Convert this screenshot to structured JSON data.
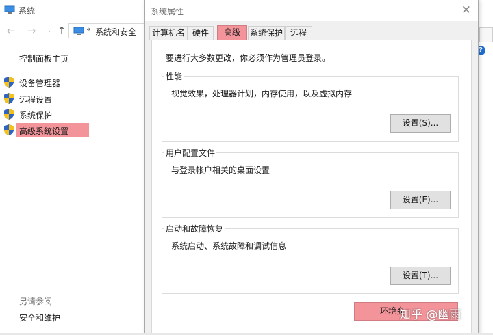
{
  "background_window": {
    "title": "系统",
    "address": {
      "separator": "«",
      "path": "系统和安全"
    },
    "left_nav": {
      "home": "控制面板主页",
      "items": [
        {
          "label": "设备管理器",
          "icon": "uac-shield-icon",
          "selected": false
        },
        {
          "label": "远程设置",
          "icon": "uac-shield-icon",
          "selected": false
        },
        {
          "label": "系统保护",
          "icon": "uac-shield-icon",
          "selected": false
        },
        {
          "label": "高级系统设置",
          "icon": "uac-shield-icon",
          "selected": true
        }
      ],
      "see_also": "另请参阅",
      "security_link": "安全和维护"
    },
    "help_glyph": "?"
  },
  "dialog": {
    "title": "系统属性",
    "close_glyph": "✕",
    "tabs": [
      {
        "label": "计算机名",
        "active": false
      },
      {
        "label": "硬件",
        "active": false
      },
      {
        "label": "高级",
        "active": true
      },
      {
        "label": "系统保护",
        "active": false
      },
      {
        "label": "远程",
        "active": false
      }
    ],
    "note": "要进行大多数更改，你必须作为管理员登录。",
    "groups": [
      {
        "title": "性能",
        "desc": "视觉效果，处理器计划，内存使用，以及虚拟内存",
        "button": "设置(S)..."
      },
      {
        "title": "用户配置文件",
        "desc": "与登录帐户相关的桌面设置",
        "button": "设置(E)..."
      },
      {
        "title": "启动和故障恢复",
        "desc": "系统启动、系统故障和调试信息",
        "button": "设置(T)..."
      }
    ],
    "env_button": "环境变"
  },
  "watermark": "知乎 @幽雨",
  "colors": {
    "highlight": "#f3949a",
    "shield_blue": "#2f64c2",
    "shield_yellow": "#f6c21a"
  }
}
